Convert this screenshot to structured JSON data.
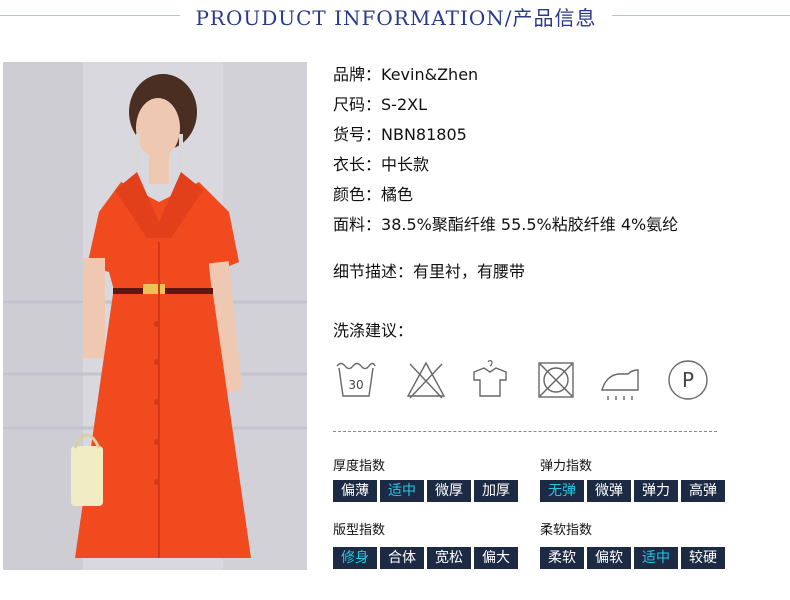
{
  "header": {
    "title": "PROUDUCT INFORMATION/产品信息"
  },
  "info": [
    {
      "label": "品牌：",
      "value": "Kevin&Zhen"
    },
    {
      "label": "尺码：",
      "value": "S-2XL"
    },
    {
      "label": "货号：",
      "value": "NBN81805"
    },
    {
      "label": "衣长：",
      "value": "中长款"
    },
    {
      "label": "颜色：",
      "value": "橘色"
    },
    {
      "label": "面料：",
      "value": "38.5%聚酯纤维 55.5%粘胶纤维 4%氨纶"
    }
  ],
  "detail": {
    "label": "细节描述：",
    "value": "有里衬，有腰带"
  },
  "care": {
    "title": "洗涤建议：",
    "wash_temp": "30",
    "dry_clean_letter": "P",
    "icons": [
      "wash-30-icon",
      "no-bleach-icon",
      "hang-dry-icon",
      "no-tumble-dry-icon",
      "iron-icon",
      "dry-clean-p-icon"
    ]
  },
  "indices": {
    "thickness": {
      "title": "厚度指数",
      "options": [
        "偏薄",
        "适中",
        "微厚",
        "加厚"
      ],
      "selected": 1
    },
    "elasticity": {
      "title": "弹力指数",
      "options": [
        "无弹",
        "微弹",
        "弹力",
        "高弹"
      ],
      "selected": 0
    },
    "fit": {
      "title": "版型指数",
      "options": [
        "修身",
        "合体",
        "宽松",
        "偏大"
      ],
      "selected": 0
    },
    "softness": {
      "title": "柔软指数",
      "options": [
        "柔软",
        "偏软",
        "适中",
        "较硬"
      ],
      "selected": 2
    }
  },
  "colors": {
    "dress": "#f04a1e",
    "index_bg": "#1c2a44",
    "index_selected": "#25c6e6",
    "header": "#2a3a8a"
  }
}
